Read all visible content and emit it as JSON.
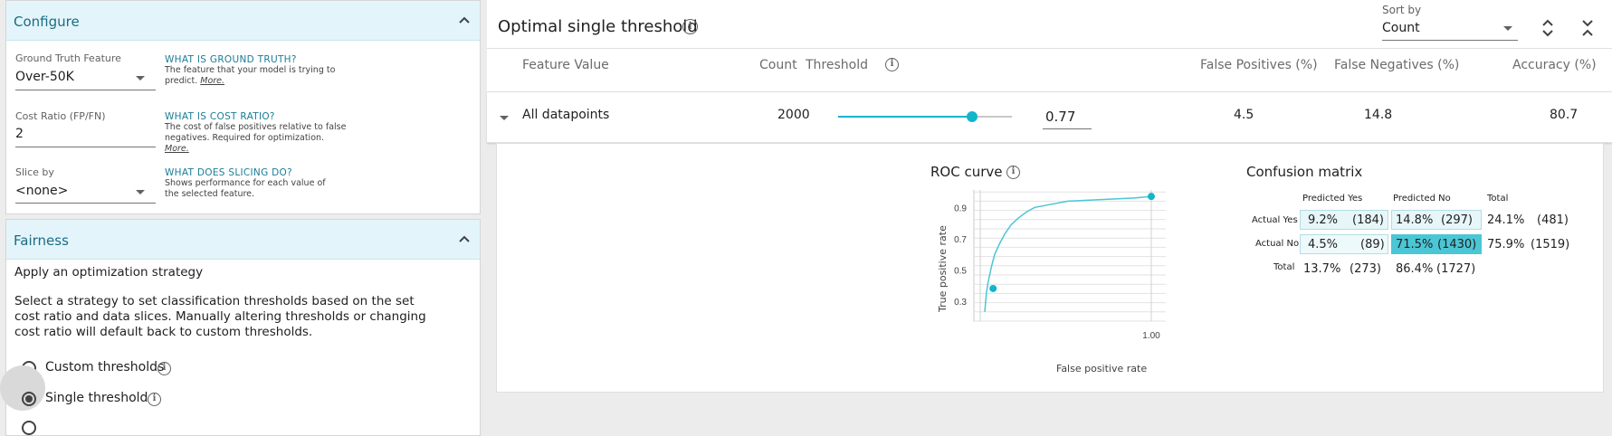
{
  "configure": {
    "title": "Configure",
    "ground_truth": {
      "label": "Ground Truth Feature",
      "value": "Over-50K",
      "help_title": "WHAT IS GROUND TRUTH?",
      "help_text": "The feature that your model is trying to predict.",
      "help_more": "More."
    },
    "cost_ratio": {
      "label": "Cost Ratio (FP/FN)",
      "value": "2",
      "help_title": "WHAT IS COST RATIO?",
      "help_text": "The cost of false positives relative to false negatives. Required for optimization.",
      "help_more": "More."
    },
    "slice_by": {
      "label": "Slice by",
      "value": "<none>",
      "help_title": "WHAT DOES SLICING DO?",
      "help_text": "Shows performance for each value of the selected feature."
    }
  },
  "fairness": {
    "title": "Fairness",
    "strategy_heading": "Apply an optimization strategy",
    "description": "Select a strategy to set classification thresholds based on the set cost ratio and data slices. Manually altering thresholds or changing cost ratio will default back to custom thresholds.",
    "options": [
      {
        "label": "Custom thresholds",
        "selected": false
      },
      {
        "label": "Single threshold",
        "selected": true
      }
    ]
  },
  "results": {
    "title": "Optimal single threshold",
    "sort_by_label": "Sort by",
    "sort_by_value": "Count",
    "columns": [
      "Feature Value",
      "Count",
      "Threshold",
      "False Positives (%)",
      "False Negatives (%)",
      "Accuracy (%)"
    ],
    "row": {
      "feature_value": "All datapoints",
      "count": "2000",
      "threshold": "0.77",
      "threshold_fraction": 0.77,
      "false_positives": "4.5",
      "false_negatives": "14.8",
      "accuracy": "80.7"
    }
  },
  "roc": {
    "title": "ROC curve",
    "xlabel": "False positive rate",
    "ylabel": "True positive rate",
    "xtick": "1.00",
    "yticks": [
      "0.9",
      "0.7",
      "0.5",
      "0.3"
    ]
  },
  "confusion": {
    "title": "Confusion matrix",
    "col_headers": [
      "Predicted Yes",
      "Predicted No",
      "Total"
    ],
    "rows": [
      {
        "label": "Actual Yes",
        "cells": [
          [
            "9.2%",
            "(184)"
          ],
          [
            "14.8%",
            "(297)"
          ],
          [
            "24.1%",
            "(481)"
          ]
        ]
      },
      {
        "label": "Actual No",
        "cells": [
          [
            "4.5%",
            "(89)"
          ],
          [
            "71.5%",
            "(1430)"
          ],
          [
            "75.9%",
            "(1519)"
          ]
        ]
      },
      {
        "label": "Total",
        "cells": [
          [
            "13.7%",
            "(273)"
          ],
          [
            "86.4%",
            "(1727)"
          ]
        ]
      }
    ]
  },
  "chart_data": {
    "type": "line",
    "title": "ROC curve",
    "xlabel": "False positive rate",
    "ylabel": "True positive rate",
    "xlim": [
      0,
      1
    ],
    "ylim": [
      0.2,
      1.0
    ],
    "series": [
      {
        "x": [
          0.0,
          0.01,
          0.02,
          0.04,
          0.06,
          0.09,
          0.12,
          0.16,
          0.2,
          0.25,
          0.3,
          0.4,
          0.5,
          0.6,
          0.7,
          0.8,
          0.9,
          1.0
        ],
        "y": [
          0.23,
          0.35,
          0.42,
          0.52,
          0.6,
          0.67,
          0.73,
          0.79,
          0.83,
          0.87,
          0.9,
          0.92,
          0.94,
          0.945,
          0.95,
          0.955,
          0.96,
          0.97
        ]
      }
    ],
    "points": [
      {
        "x": 0.05,
        "y": 0.38
      },
      {
        "x": 1.0,
        "y": 0.97
      }
    ],
    "colors": {
      "line": "#4bc6d5",
      "point": "#12b5cb"
    }
  },
  "colors": {
    "accent": "#12b5cb",
    "header_bg": "#e3f5fa",
    "header_text": "#1a6c86",
    "cm_light": "#e6f6f9",
    "cm_dark": "#4bc6d5"
  }
}
